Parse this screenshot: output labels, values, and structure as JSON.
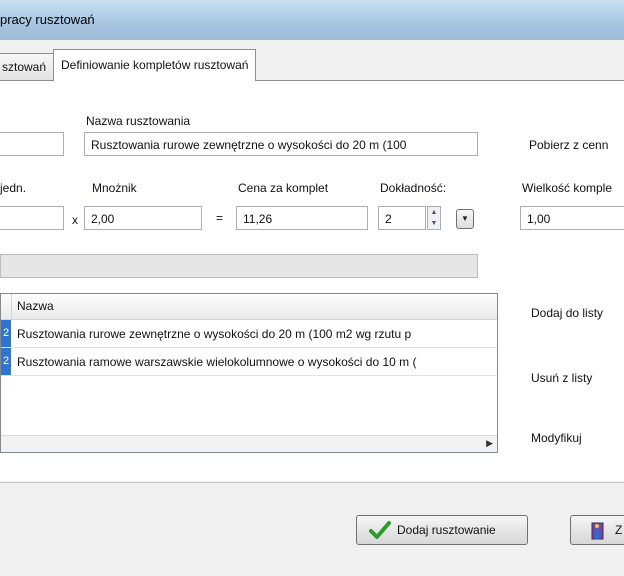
{
  "window": {
    "title": "pracy rusztowań"
  },
  "tabs": [
    {
      "label": "sztowań",
      "active": false
    },
    {
      "label": "Definiowanie kompletów rusztowań",
      "active": true
    }
  ],
  "form": {
    "name_label": "Nazwa rusztowania",
    "name_value": "Rusztowania rurowe zewnętrzne o wysokości do 20 m (100",
    "fetch_label": "Pobierz z cenn",
    "unit_label": "jedn.",
    "multiplier_label": "Mnożnik",
    "multiplier_value": "2,00",
    "times_op": "x",
    "equals_op": "=",
    "price_label": "Cena za komplet",
    "price_value": "11,26",
    "precision_label": "Dokładność:",
    "precision_value": "2",
    "set_size_label": "Wielkość komple",
    "set_size_value": "1,00"
  },
  "grid": {
    "columns": [
      "Nazwa"
    ],
    "rows": [
      {
        "num": "2",
        "name": "Rusztowania rurowe zewnętrzne o wysokości do 20 m (100 m2 wg rzutu p"
      },
      {
        "num": "2",
        "name": "Rusztowania ramowe warszawskie wielokolumnowe o wysokości do 10 m ("
      }
    ]
  },
  "side_actions": {
    "add_to_list": "Dodaj do listy",
    "remove_from_list": "Usuń z listy",
    "modify": "Modyfikuj"
  },
  "buttons": {
    "add_scaffold": "Dodaj rusztowanie",
    "close_partial": "Z"
  },
  "colors": {
    "selection": "#2f74d0",
    "accept_check": "#2e9b2e",
    "title_bar": "#a9c7e3"
  },
  "icons": {
    "add_scaffold": "checkmark-icon",
    "close": "door-exit-icon",
    "spin": "spinner-arrows-icon",
    "dropdown": "chevron-down-icon"
  }
}
